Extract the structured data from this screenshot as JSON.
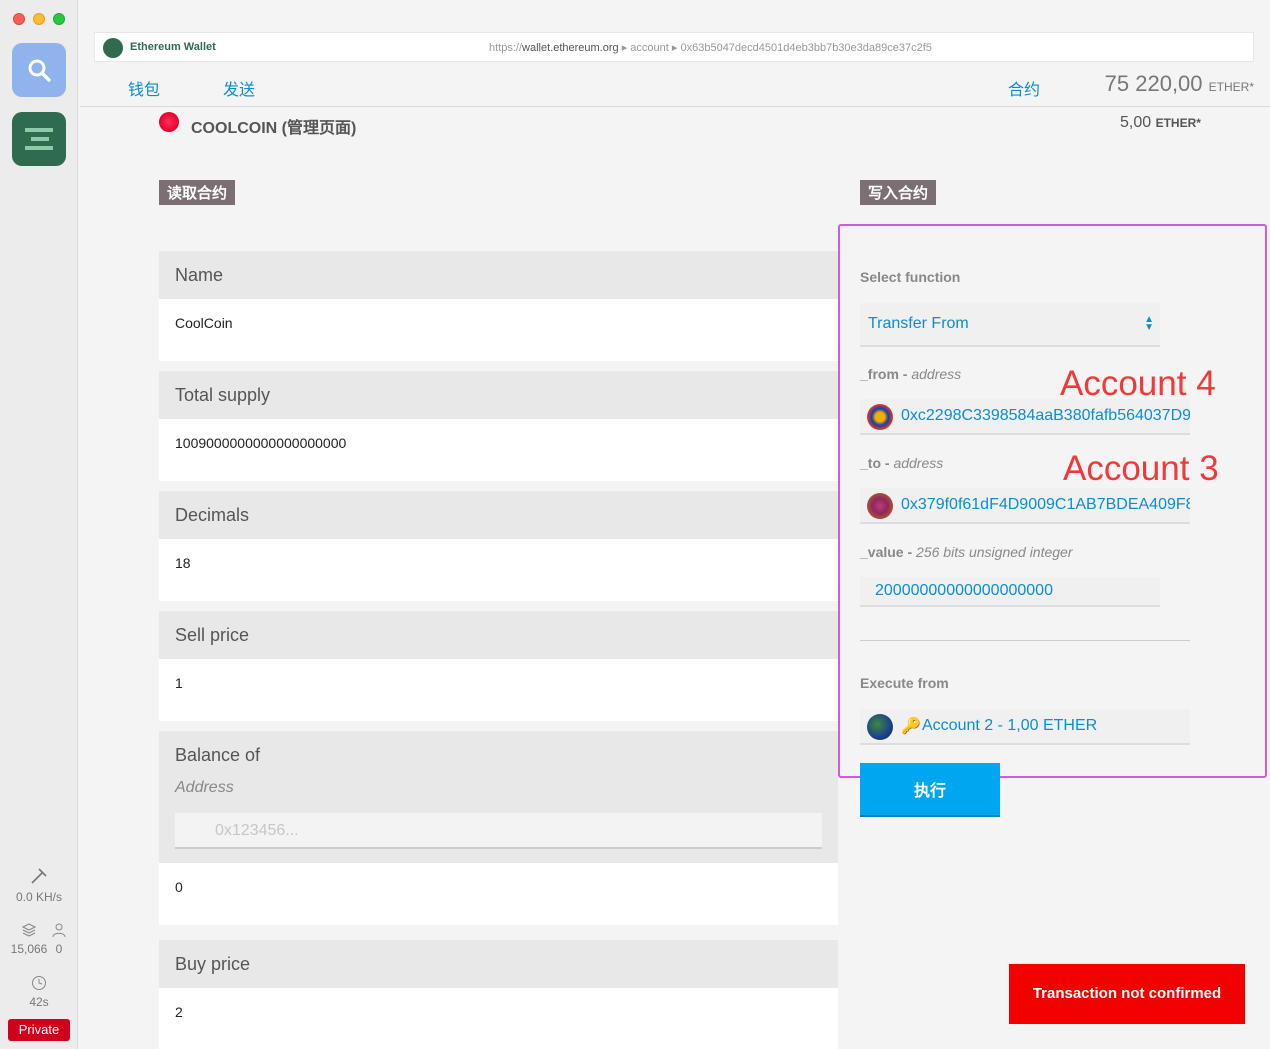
{
  "url_bar": {
    "app_name": "Ethereum Wallet",
    "scheme": "https://",
    "host": "wallet.ethereum.org",
    "crumb_1": "account",
    "crumb_2": "0x63b5047decd4501d4eb3bb7b30e3da89ce37c2f5"
  },
  "nav": {
    "wallet": "钱包",
    "send": "发送",
    "contracts": "合约",
    "balance_value": "75 220,00",
    "balance_unit": "ETHER*"
  },
  "contract": {
    "title": "COOLCOIN (管理页面)",
    "balance_value": "5,00",
    "balance_unit": "ETHER*"
  },
  "sections": {
    "read": "读取合约",
    "write": "写入合约"
  },
  "read_fields": [
    {
      "label": "Name",
      "value": "CoolCoin"
    },
    {
      "label": "Total supply",
      "value": "1009000000000000000000"
    },
    {
      "label": "Decimals",
      "value": "18"
    },
    {
      "label": "Sell price",
      "value": "1"
    },
    {
      "label": "Balance of",
      "address_label": "Address",
      "address_placeholder": "0x123456...",
      "value": "0"
    },
    {
      "label": "Buy price",
      "value": "2"
    }
  ],
  "write": {
    "select_function_label": "Select function",
    "selected_function": "Transfer From",
    "from_label": "_from",
    "from_type": "address",
    "from_address": "0xc2298C3398584aaB380fafb564037D9",
    "to_label": "_to",
    "to_type": "address",
    "to_address": "0x379f0f61dF4D9009C1AB7BDEA409F8",
    "value_label": "_value",
    "value_type": "256 bits unsigned integer",
    "value": "20000000000000000000",
    "execute_from_label": "Execute from",
    "execute_from_account": "Account 2 - 1,00 ETHER",
    "execute_button": "执行"
  },
  "annotations": {
    "from": "Account 4",
    "to": "Account 3"
  },
  "sidebar_stats": {
    "hashrate": "0.0 KH/s",
    "block": "15,066",
    "peers": "0",
    "time": "42s",
    "network": "Private"
  },
  "toast": "Transaction not confirmed",
  "colors": {
    "accent": "#0b8ed2",
    "highlight_border": "#d35ad8",
    "toast": "#f20000",
    "annotation": "#f03a3a"
  }
}
